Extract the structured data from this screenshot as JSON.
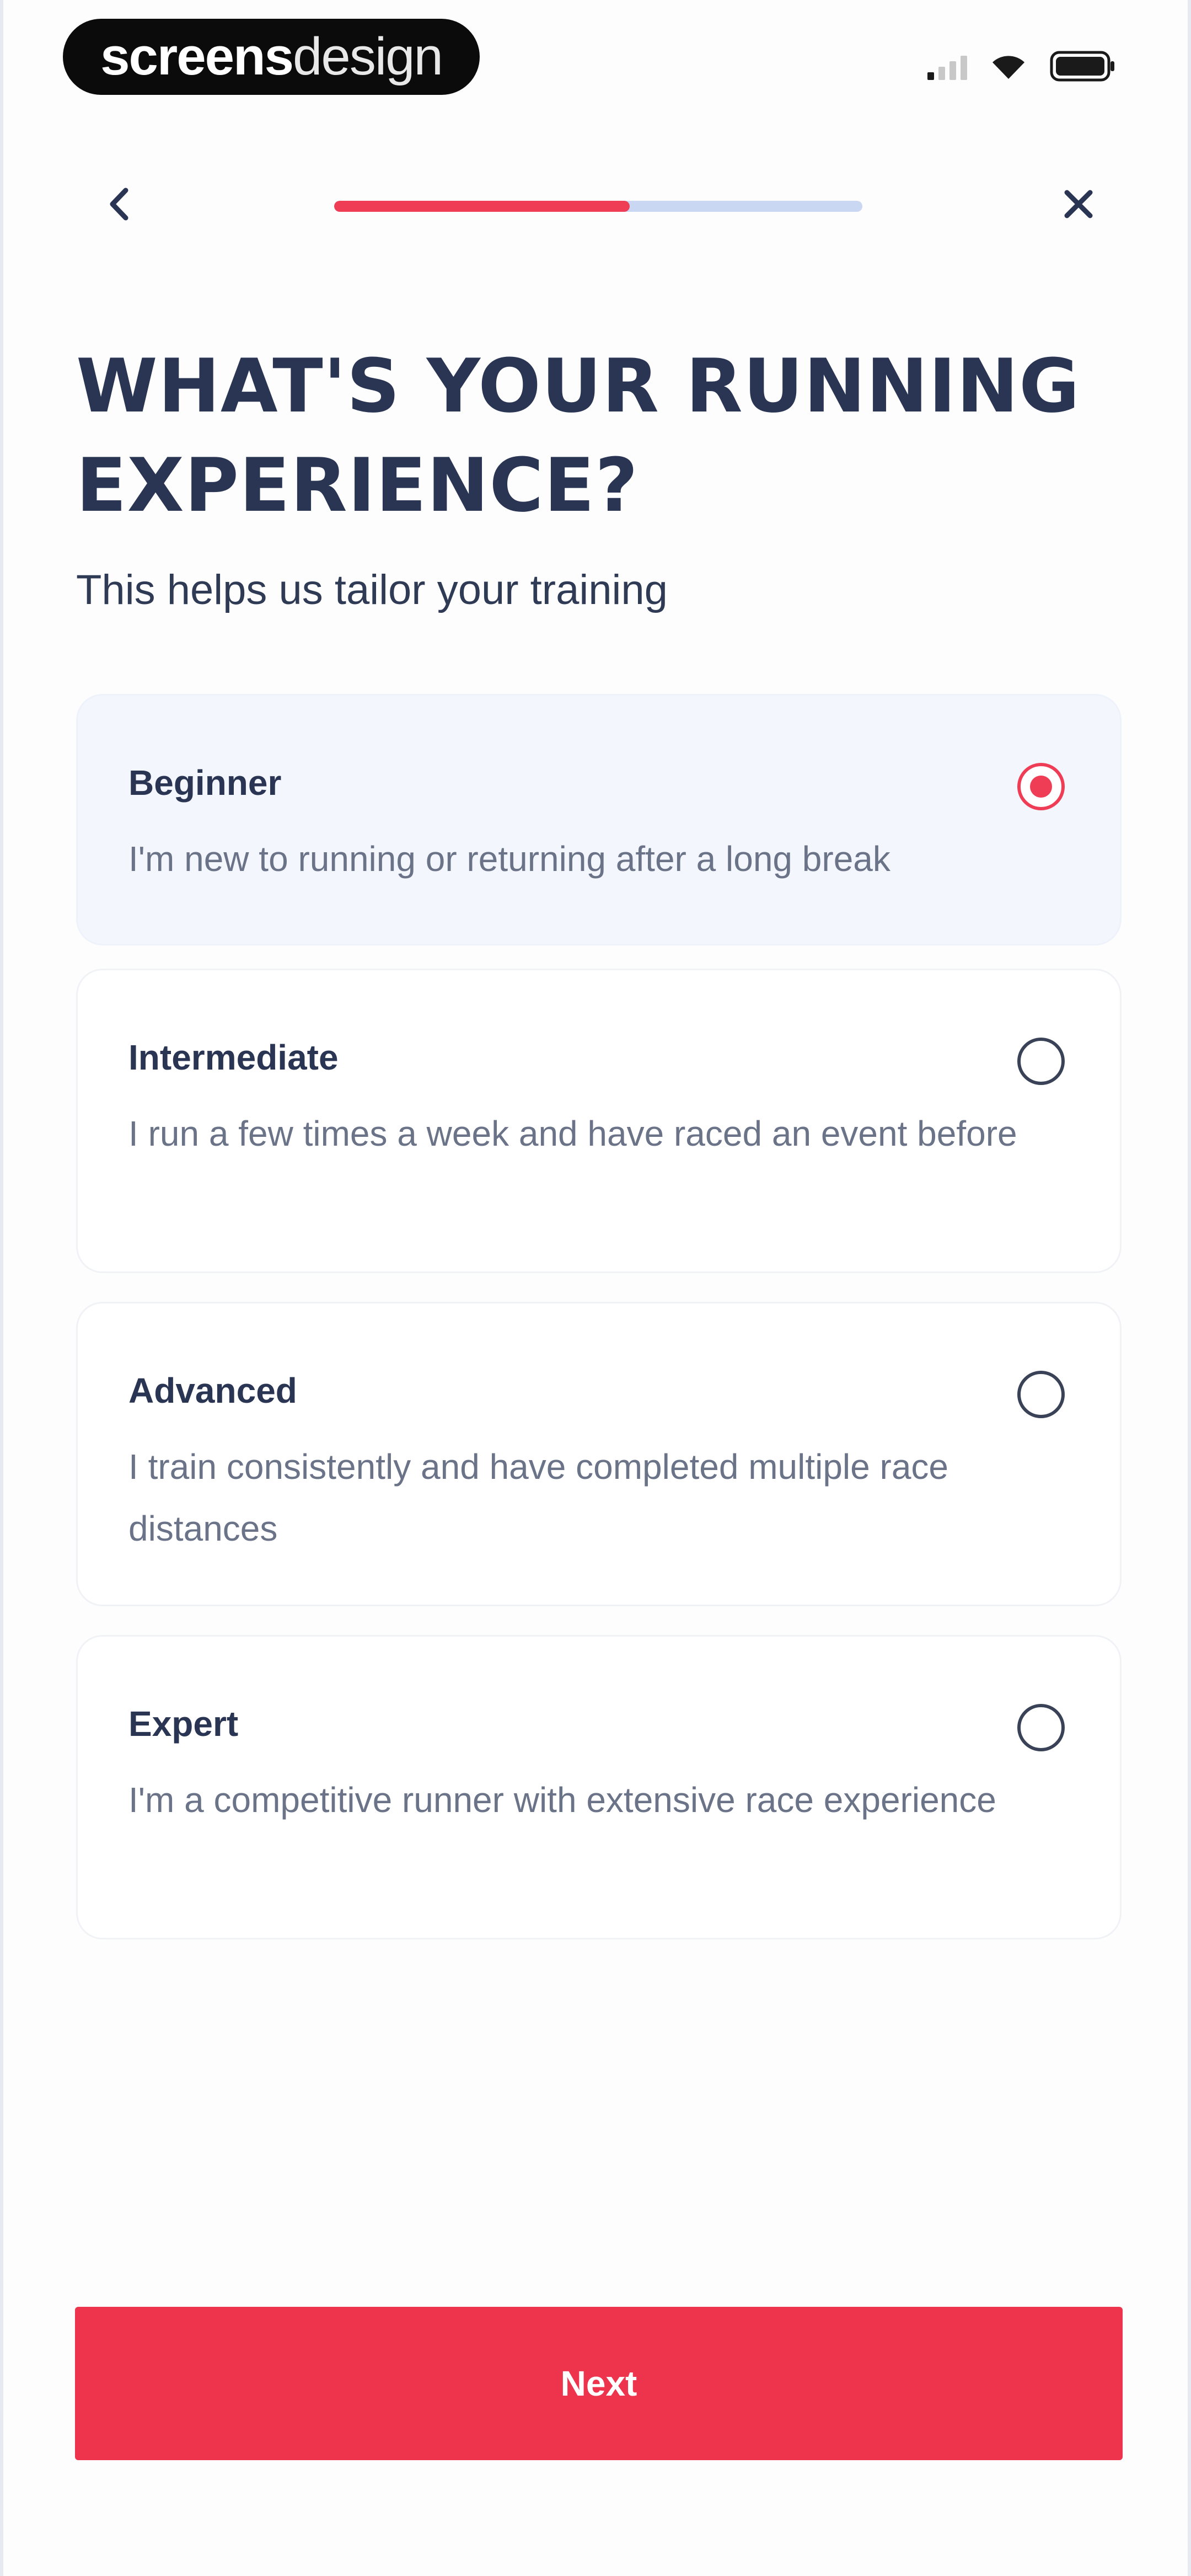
{
  "status_bar": {
    "watermark_bold": "screens",
    "watermark_light": "design",
    "signal_icon": "cellular-signal-icon",
    "wifi_icon": "wifi-icon",
    "battery_icon": "battery-icon"
  },
  "nav": {
    "back_icon": "chevron-left-icon",
    "close_icon": "close-icon",
    "progress_fraction": 0.56,
    "progress_color": "#ee3d55",
    "progress_track_color": "#c9d7f2"
  },
  "header": {
    "title": "WHAT'S YOUR RUNNING EXPERIENCE?",
    "subtitle": "This helps us tailor your training"
  },
  "options": [
    {
      "label": "Beginner",
      "description": "I'm new to running or returning after a long break",
      "selected": true
    },
    {
      "label": "Intermediate",
      "description": "I run a few times a week and have raced an event before",
      "selected": false
    },
    {
      "label": "Advanced",
      "description": "I train consistently and have completed multiple race distances",
      "selected": false
    },
    {
      "label": "Expert",
      "description": "I'm a competitive runner with extensive race experience",
      "selected": false
    }
  ],
  "footer": {
    "next_label": "Next",
    "accent_color": "#ee334d"
  }
}
